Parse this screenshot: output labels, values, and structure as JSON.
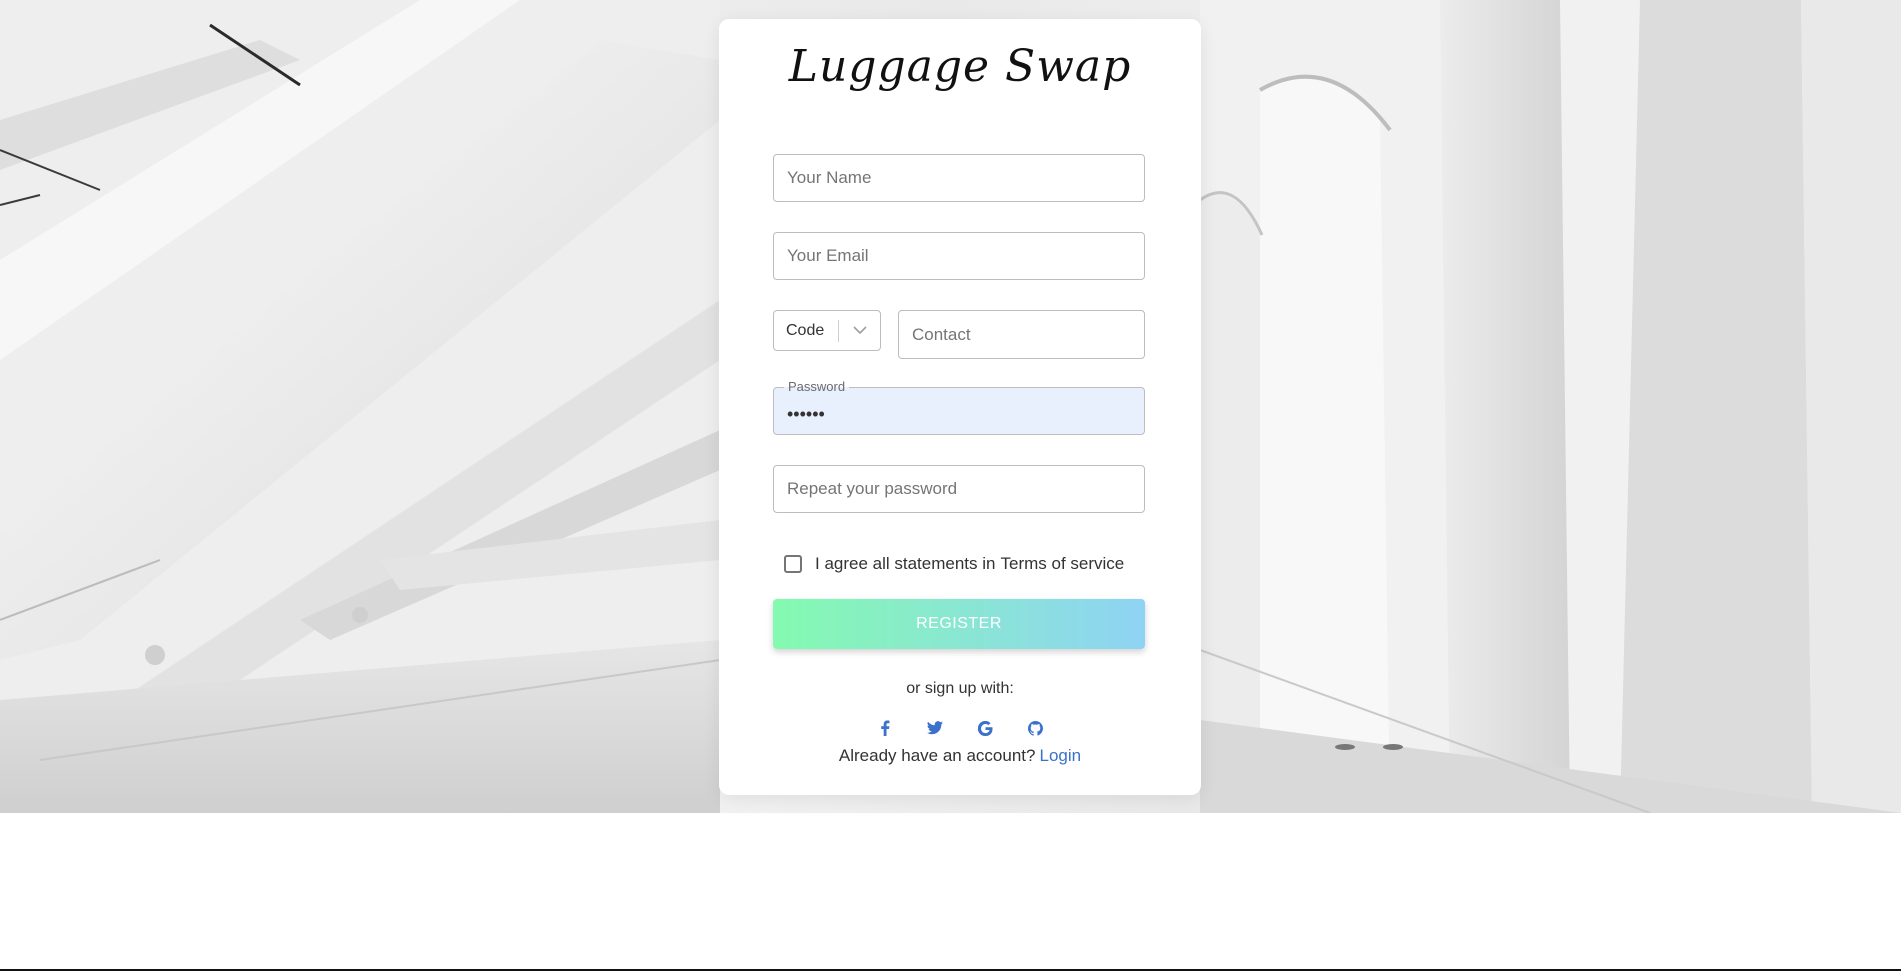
{
  "brand": {
    "title": "Luggage Swap"
  },
  "form": {
    "name_placeholder": "Your Name",
    "email_placeholder": "Your Email",
    "code_label": "Code",
    "contact_placeholder": "Contact",
    "password_label": "Password",
    "password_value": "••••••",
    "repeat_placeholder": "Repeat your password",
    "agree_text": "I agree all statements in",
    "terms_link": "Terms of service",
    "register_label": "REGISTER"
  },
  "social": {
    "or_text": "or sign up with:",
    "icons": [
      "facebook-icon",
      "twitter-icon",
      "google-icon",
      "github-icon"
    ]
  },
  "footer": {
    "already_text": "Already have an account?",
    "login_link": "Login"
  },
  "colors": {
    "gradient_start": "#84fab0",
    "gradient_end": "#8fd3f4",
    "link": "#3b71ca",
    "autofill_bg": "#e8f0fe",
    "social_icon": "#3b71ca"
  }
}
